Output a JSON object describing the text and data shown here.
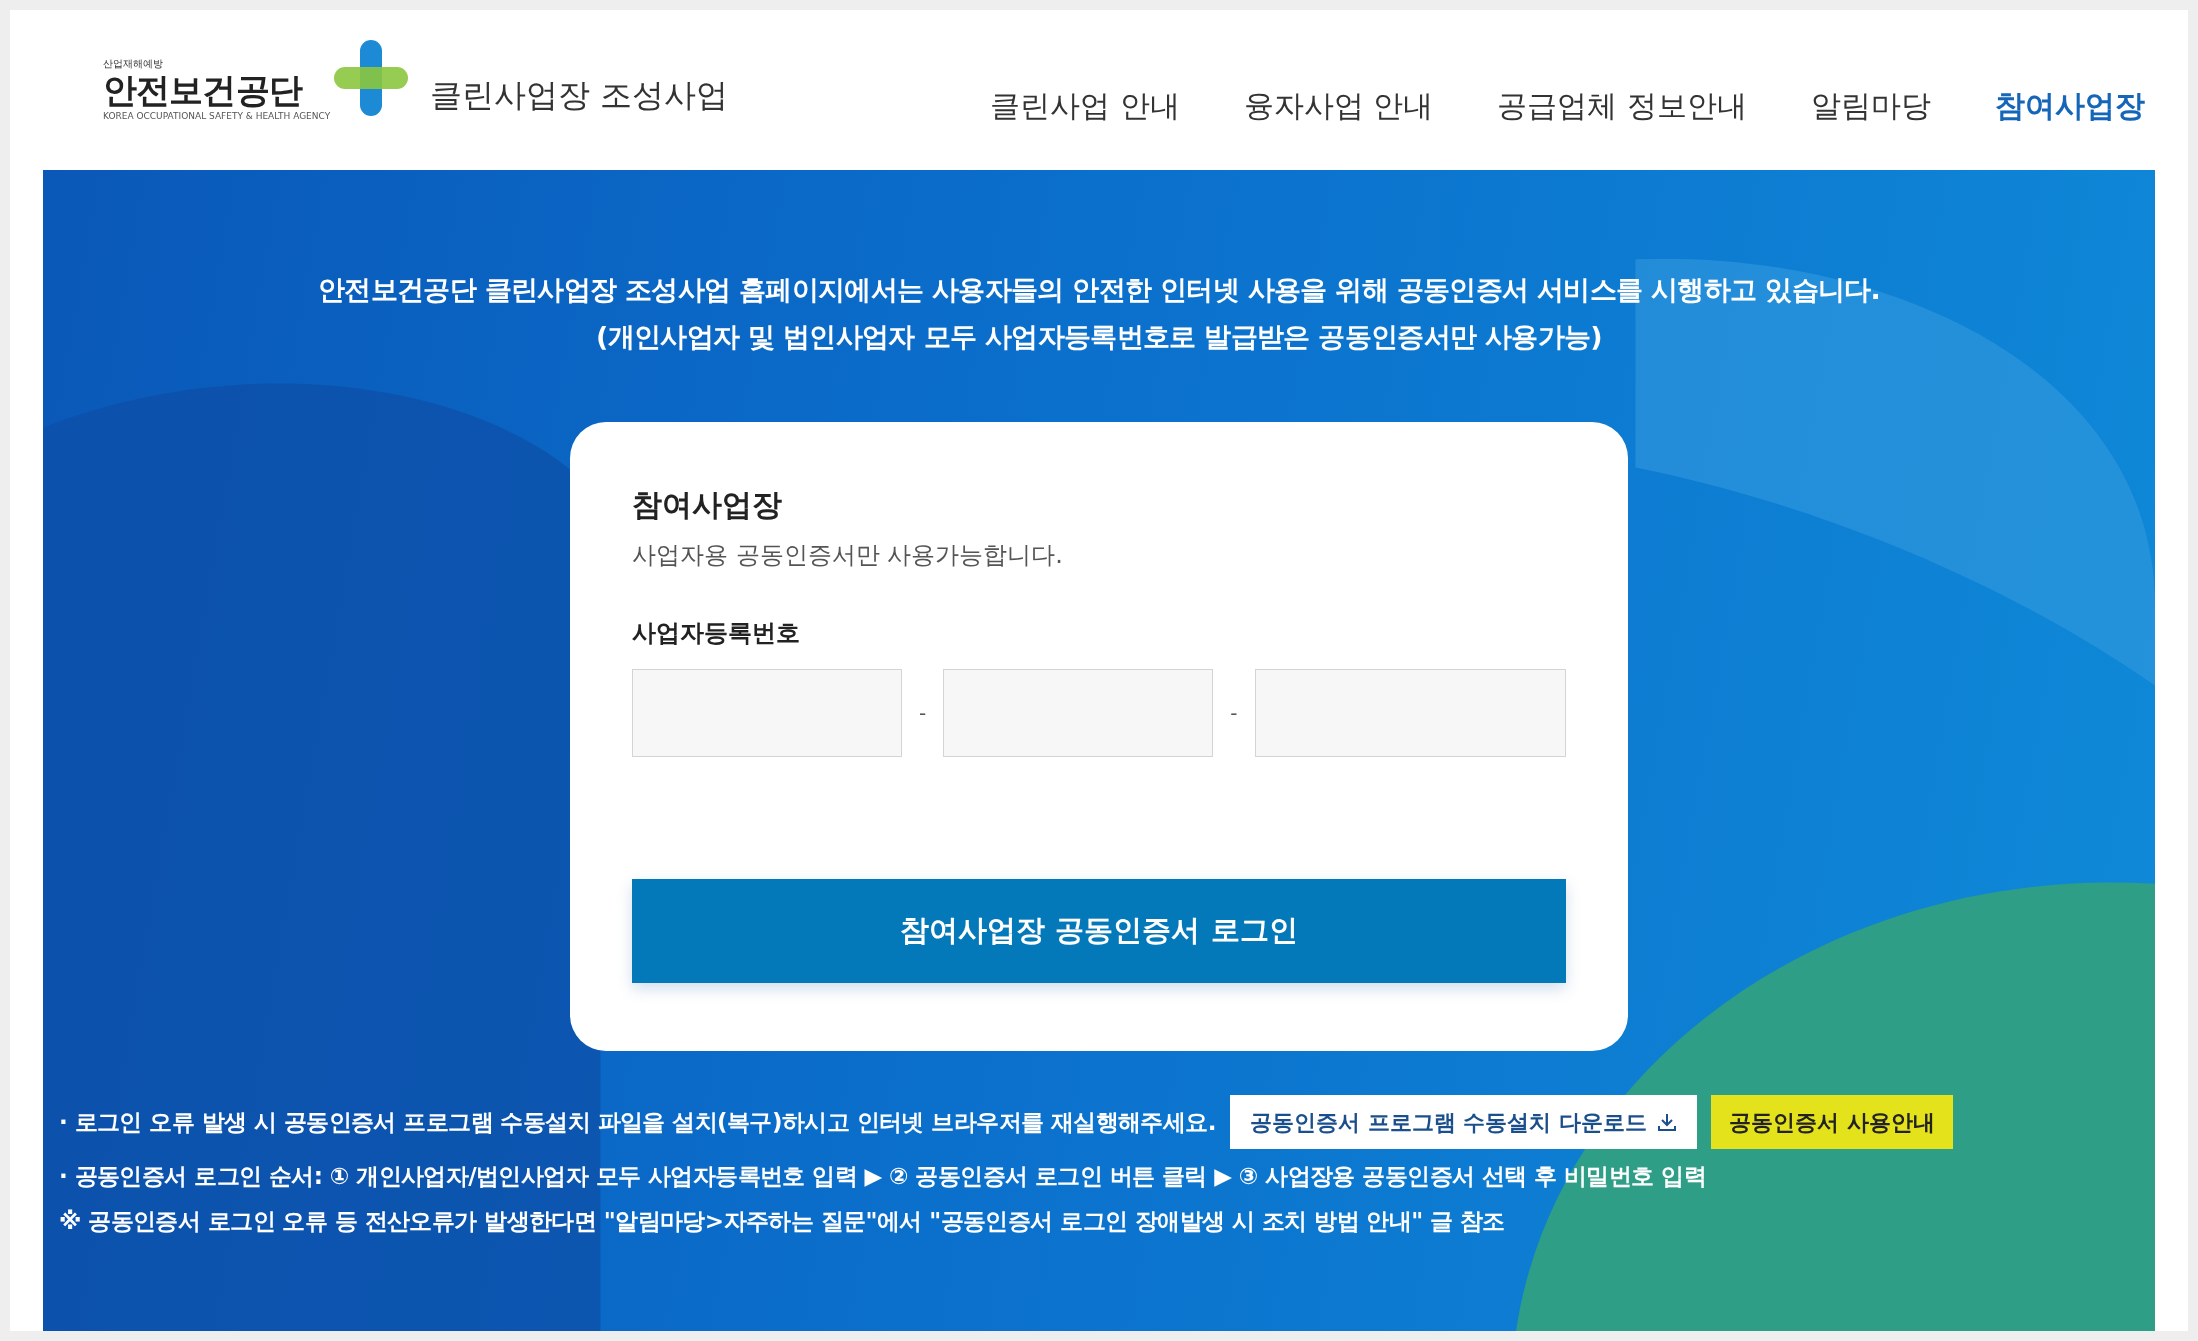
{
  "logo": {
    "tagline": "산업재해예방",
    "name": "안전보건공단",
    "subtitle": "KOREA OCCUPATIONAL SAFETY & HEALTH AGENCY"
  },
  "site_title": "클린사업장 조성사업",
  "nav": [
    {
      "label": "클린사업 안내",
      "selected": false
    },
    {
      "label": "융자사업 안내",
      "selected": false
    },
    {
      "label": "공급업체 정보안내",
      "selected": false
    },
    {
      "label": "알림마당",
      "selected": false
    },
    {
      "label": "참여사업장",
      "selected": true
    }
  ],
  "notice": [
    "안전보건공단 클린사업장 조성사업 홈페이지에서는 사용자들의 안전한 인터넷 사용을 위해 공동인증서 서비스를 시행하고 있습니다.",
    "(개인사업자 및 법인사업자 모두 사업자등록번호로 발급받은 공동인증서만 사용가능)"
  ],
  "login_card": {
    "title": "참여사업장",
    "description": "사업자용 공동인증서만 사용가능합니다.",
    "field_label": "사업자등록번호",
    "separators": [
      "-",
      "-"
    ],
    "login_button": "참여사업장 공동인증서 로그인"
  },
  "help": [
    {
      "kind": "with_buttons",
      "text": "· 로그인 오류 발생 시 공동인증서 프로그램 수동설치 파일을 설치(복구)하시고 인터넷 브라우저를 재실행해주세요.",
      "buttons": [
        {
          "label": "공동인증서 프로그램 수동설치 다운로드",
          "kind": "download"
        },
        {
          "label": "공동인증서 사용안내",
          "kind": "highlight"
        }
      ]
    },
    {
      "kind": "plain",
      "text": "· 공동인증서 로그인 순서: ① 개인사업자/법인사업자 모두 사업자등록번호 입력 ▶ ② 공동인증서 로그인 버튼 클릭 ▶ ③ 사업장용 공동인증서 선택 후 비밀번호 입력"
    },
    {
      "kind": "plain",
      "text": "※ 공동인증서 로그인 오류 등 전산오류가 발생한다면 \"알림마당>자주하는 질문\"에서 \"공동인증서 로그인 장애발생 시 조치 방법 안내\" 글 참조"
    }
  ]
}
